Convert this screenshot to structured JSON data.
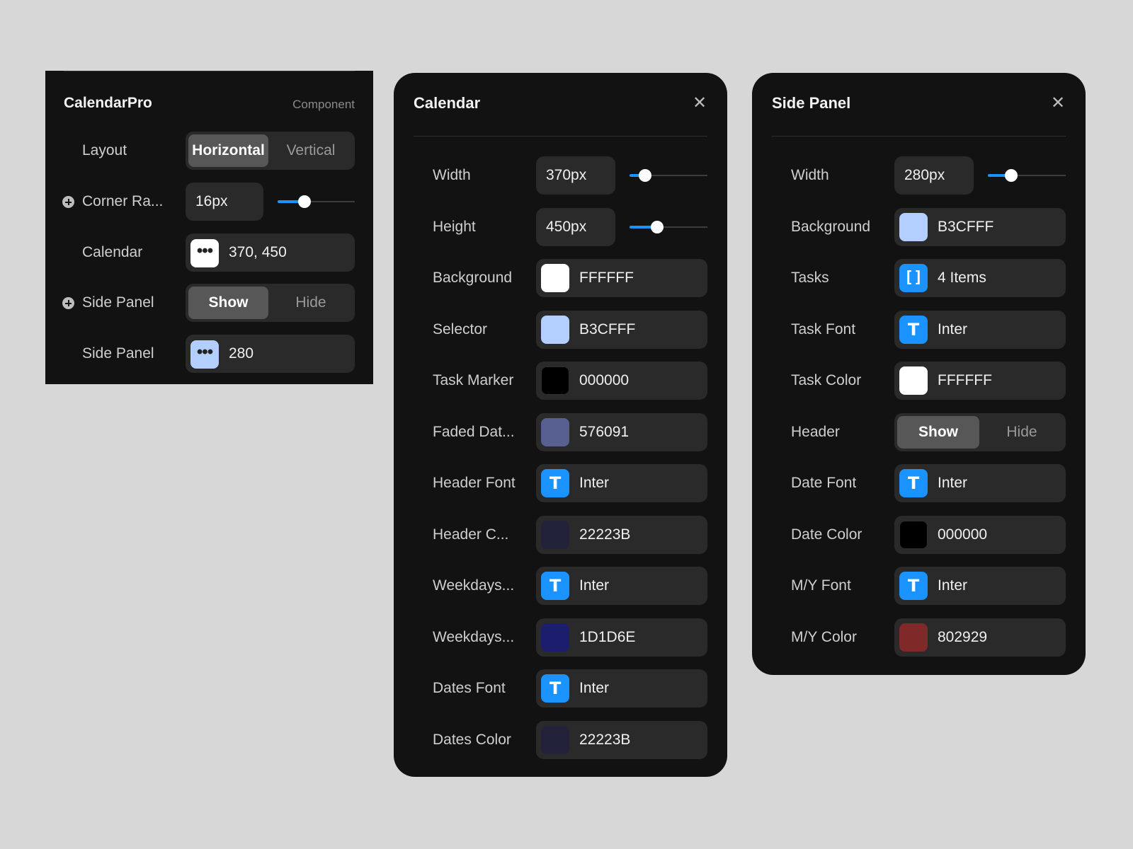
{
  "component_panel": {
    "title": "CalendarPro",
    "subtitle": "Component",
    "rows": [
      {
        "label": "Layout",
        "type": "segmented",
        "options": [
          "Horizontal",
          "Vertical"
        ],
        "selected": 0
      },
      {
        "label": "Corner Ra...",
        "type": "slider",
        "value": "16px",
        "level": 0.35,
        "expandable": true
      },
      {
        "label": "Calendar",
        "type": "object",
        "value": "370, 450",
        "chip_color": "#ffffff"
      },
      {
        "label": "Side Panel",
        "type": "segmented",
        "options": [
          "Show",
          "Hide"
        ],
        "selected": 0,
        "expandable": true
      },
      {
        "label": "Side Panel",
        "type": "object",
        "value": "280",
        "chip_color": "#b3cfff"
      }
    ]
  },
  "calendar_panel": {
    "title": "Calendar",
    "close_icon": "close-icon",
    "rows": [
      {
        "label": "Width",
        "type": "slider",
        "value": "370px",
        "level": 0.2
      },
      {
        "label": "Height",
        "type": "slider",
        "value": "450px",
        "level": 0.35
      },
      {
        "label": "Background",
        "type": "color",
        "value": "FFFFFF",
        "color": "#ffffff"
      },
      {
        "label": "Selector",
        "type": "color",
        "value": "B3CFFF",
        "color": "#b3cfff"
      },
      {
        "label": "Task Marker",
        "type": "color",
        "value": "000000",
        "color": "#000000"
      },
      {
        "label": "Faded Dat...",
        "type": "color",
        "value": "576091",
        "color": "#576091"
      },
      {
        "label": "Header Font",
        "type": "font",
        "value": "Inter"
      },
      {
        "label": "Header C...",
        "type": "color",
        "value": "22223B",
        "color": "#22223b"
      },
      {
        "label": "Weekdays...",
        "type": "font",
        "value": "Inter"
      },
      {
        "label": "Weekdays...",
        "type": "color",
        "value": "1D1D6E",
        "color": "#1d1d6e"
      },
      {
        "label": "Dates Font",
        "type": "font",
        "value": "Inter"
      },
      {
        "label": "Dates Color",
        "type": "color",
        "value": "22223B",
        "color": "#22223b"
      }
    ]
  },
  "side_panel": {
    "title": "Side Panel",
    "close_icon": "close-icon",
    "rows": [
      {
        "label": "Width",
        "type": "slider",
        "value": "280px",
        "level": 0.3
      },
      {
        "label": "Background",
        "type": "color",
        "value": "B3CFFF",
        "color": "#b3cfff"
      },
      {
        "label": "Tasks",
        "type": "array",
        "value": "4 Items"
      },
      {
        "label": "Task Font",
        "type": "font",
        "value": "Inter"
      },
      {
        "label": "Task Color",
        "type": "color",
        "value": "FFFFFF",
        "color": "#ffffff"
      },
      {
        "label": "Header",
        "type": "segmented",
        "options": [
          "Show",
          "Hide"
        ],
        "selected": 0
      },
      {
        "label": "Date Font",
        "type": "font",
        "value": "Inter"
      },
      {
        "label": "Date Color",
        "type": "color",
        "value": "000000",
        "color": "#000000"
      },
      {
        "label": "M/Y Font",
        "type": "font",
        "value": "Inter"
      },
      {
        "label": "M/Y Color",
        "type": "color",
        "value": "802929",
        "color": "#802929"
      }
    ]
  },
  "accent_color": "#1a93ff",
  "icons": {
    "font": "T",
    "array": "[]",
    "object": "•••"
  }
}
